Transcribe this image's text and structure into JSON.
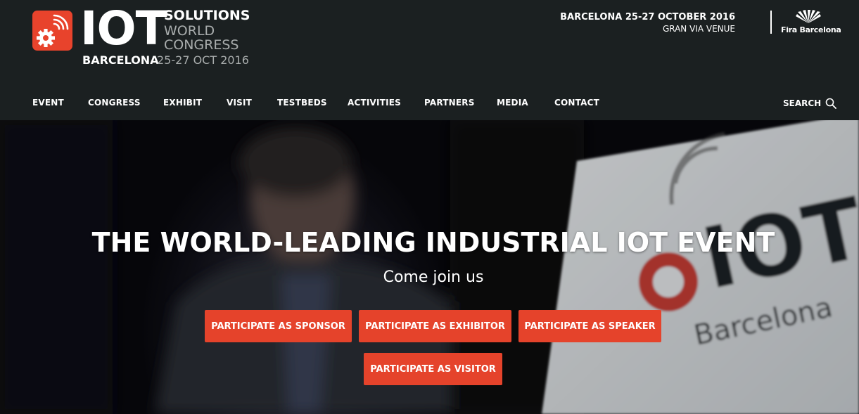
{
  "logo": {
    "icon": "gear-wifi-icon",
    "iot": "IOT",
    "solutions": "SOLUTIONS",
    "world": "WORLD",
    "congress": "CONGRESS",
    "city": "BARCELONA",
    "dates": "25-27 OCT 2016"
  },
  "event": {
    "date": "BARCELONA 25-27 OCTOBER 2016",
    "venue": "GRAN VIA VENUE"
  },
  "fira": {
    "label": "Fira Barcelona",
    "icon": "fira-barcelona-logo"
  },
  "nav": {
    "items": [
      "EVENT",
      "CONGRESS",
      "EXHIBIT",
      "VISIT",
      "TESTBEDS",
      "ACTIVITIES",
      "PARTNERS",
      "MEDIA",
      "CONTACT"
    ],
    "search_label": "SEARCH",
    "search_icon": "search-icon"
  },
  "hero": {
    "title": "THE WORLD-LEADING INDUSTRIAL IOT EVENT",
    "subtitle": "Come join us",
    "buttons": {
      "sponsor": "PARTICIPATE AS SPONSOR",
      "exhibitor": "PARTICIPATE AS EXHIBITOR",
      "speaker": "PARTICIPATE AS SPEAKER",
      "visitor": "PARTICIPATE AS VISITOR"
    }
  },
  "colors": {
    "accent": "#e5432b",
    "header_bg": "#1b2021",
    "text": "#ffffff",
    "muted": "#a9adad"
  }
}
